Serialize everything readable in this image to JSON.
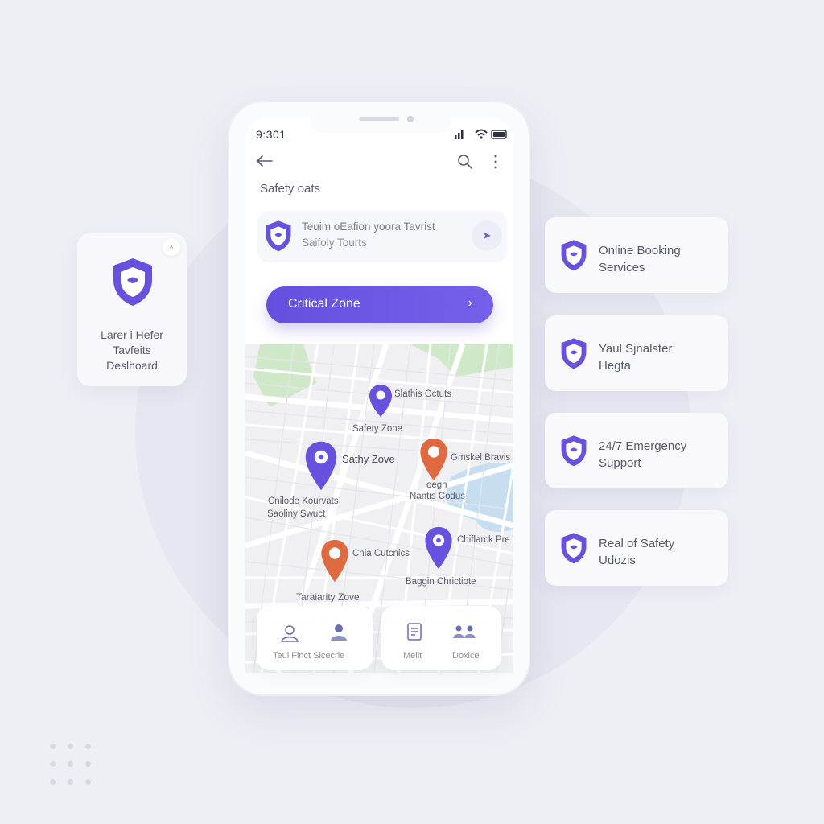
{
  "status": {
    "time": "9:301"
  },
  "header": {
    "title": "Safety oats"
  },
  "tour_card": {
    "line1": "Teuim oEafion yoora Tavrist",
    "line2": "Saifoly Tourts"
  },
  "primary_button": {
    "label": "Critical Zone"
  },
  "map": {
    "labels": {
      "l1": "Slathis Octuts",
      "l2": "Safety Zone",
      "l3": "Sathy Zove",
      "l4": "Gmskel Bravis",
      "l5a": "Cnilode Kourvats",
      "l5b": "Saoliny Swuct",
      "l6a": "oegn",
      "l6b": "Nantis Codus",
      "l7": "Chiflarck Pre",
      "l8": "Cnia Cutcnics",
      "l9": "Baggin Chrictiote",
      "l10": "Taraiarity Zove"
    }
  },
  "bottom_tabs": {
    "left": {
      "label": "Teul Finct Sicecrie"
    },
    "right": {
      "label1": "Melit",
      "label2": "Doxice"
    }
  },
  "left_card": {
    "line1": "Larer i Hefer",
    "line2": "Tavfeits",
    "line3": "Deslhoard",
    "close": "×"
  },
  "features": [
    {
      "line1": "Online Booking",
      "line2": "Services"
    },
    {
      "line1": "Yaul Sjnalster",
      "line2": "Hegta"
    },
    {
      "line1": "24/7 Emergency",
      "line2": "Support"
    },
    {
      "line1": "Real of Safety",
      "line2": "Udozis"
    }
  ],
  "colors": {
    "accent": "#6450e0",
    "warning": "#e06a3f",
    "water": "#c7def1",
    "park": "#cfe9c8"
  },
  "icons": [
    "back-arrow-icon",
    "search-icon",
    "more-vertical-icon",
    "shield-icon",
    "chevron-right-icon",
    "location-pin-icon",
    "person-icon",
    "document-icon",
    "group-icon",
    "close-icon"
  ]
}
